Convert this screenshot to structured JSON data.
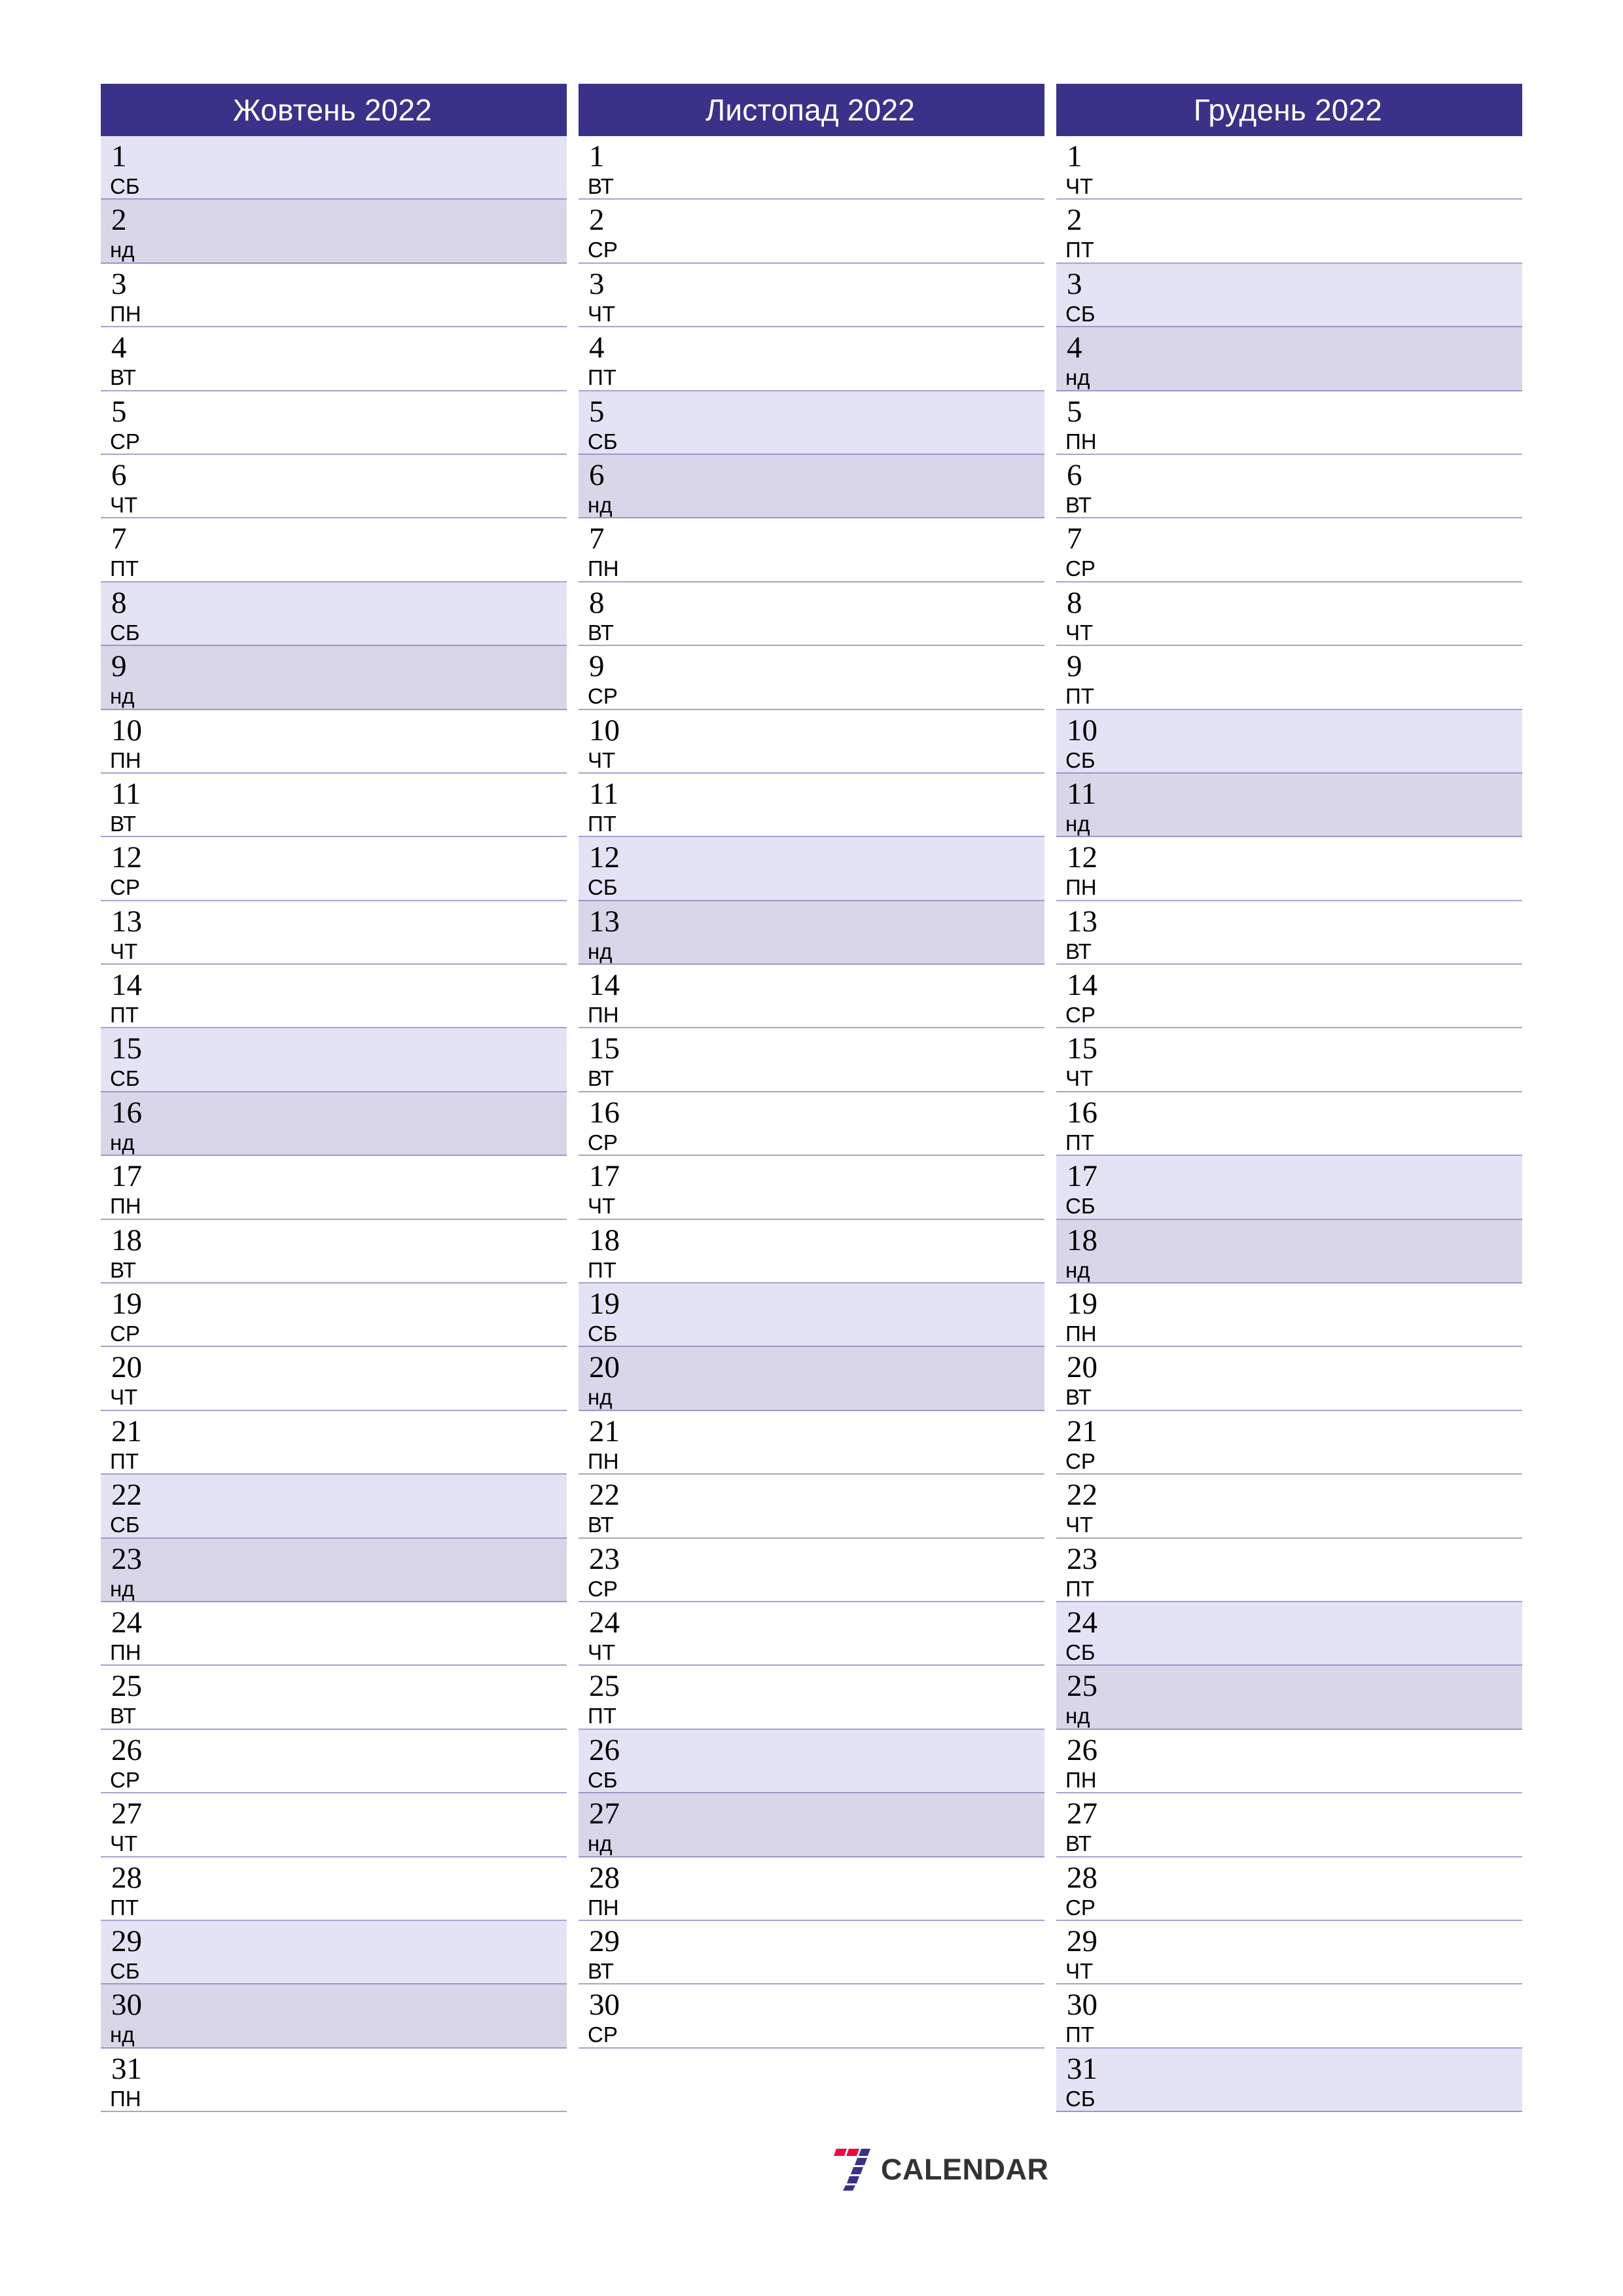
{
  "colors": {
    "header_bg": "#3a3189",
    "saturday_bg": "#e3e3f5",
    "sunday_bg": "#dad6e9",
    "rule": "#9a97c6",
    "logo_red": "#ee0a3f",
    "logo_navy": "#3a3189",
    "logo_text": "#333333",
    "text": "#000000"
  },
  "logo": {
    "mark": "seven-bars-icon",
    "word": "CALENDAR"
  },
  "months": [
    {
      "title": "Жовтень 2022",
      "days": [
        {
          "num": "1",
          "abbr": "СБ",
          "kind": "sat"
        },
        {
          "num": "2",
          "abbr": "нд",
          "kind": "sun"
        },
        {
          "num": "3",
          "abbr": "ПН",
          "kind": "weekday"
        },
        {
          "num": "4",
          "abbr": "ВТ",
          "kind": "weekday"
        },
        {
          "num": "5",
          "abbr": "СР",
          "kind": "weekday"
        },
        {
          "num": "6",
          "abbr": "ЧТ",
          "kind": "weekday"
        },
        {
          "num": "7",
          "abbr": "ПТ",
          "kind": "weekday"
        },
        {
          "num": "8",
          "abbr": "СБ",
          "kind": "sat"
        },
        {
          "num": "9",
          "abbr": "нд",
          "kind": "sun"
        },
        {
          "num": "10",
          "abbr": "ПН",
          "kind": "weekday"
        },
        {
          "num": "11",
          "abbr": "ВТ",
          "kind": "weekday"
        },
        {
          "num": "12",
          "abbr": "СР",
          "kind": "weekday"
        },
        {
          "num": "13",
          "abbr": "ЧТ",
          "kind": "weekday"
        },
        {
          "num": "14",
          "abbr": "ПТ",
          "kind": "weekday"
        },
        {
          "num": "15",
          "abbr": "СБ",
          "kind": "sat"
        },
        {
          "num": "16",
          "abbr": "нд",
          "kind": "sun"
        },
        {
          "num": "17",
          "abbr": "ПН",
          "kind": "weekday"
        },
        {
          "num": "18",
          "abbr": "ВТ",
          "kind": "weekday"
        },
        {
          "num": "19",
          "abbr": "СР",
          "kind": "weekday"
        },
        {
          "num": "20",
          "abbr": "ЧТ",
          "kind": "weekday"
        },
        {
          "num": "21",
          "abbr": "ПТ",
          "kind": "weekday"
        },
        {
          "num": "22",
          "abbr": "СБ",
          "kind": "sat"
        },
        {
          "num": "23",
          "abbr": "нд",
          "kind": "sun"
        },
        {
          "num": "24",
          "abbr": "ПН",
          "kind": "weekday"
        },
        {
          "num": "25",
          "abbr": "ВТ",
          "kind": "weekday"
        },
        {
          "num": "26",
          "abbr": "СР",
          "kind": "weekday"
        },
        {
          "num": "27",
          "abbr": "ЧТ",
          "kind": "weekday"
        },
        {
          "num": "28",
          "abbr": "ПТ",
          "kind": "weekday"
        },
        {
          "num": "29",
          "abbr": "СБ",
          "kind": "sat"
        },
        {
          "num": "30",
          "abbr": "нд",
          "kind": "sun"
        },
        {
          "num": "31",
          "abbr": "ПН",
          "kind": "weekday"
        }
      ]
    },
    {
      "title": "Листопад 2022",
      "days": [
        {
          "num": "1",
          "abbr": "ВТ",
          "kind": "weekday"
        },
        {
          "num": "2",
          "abbr": "СР",
          "kind": "weekday"
        },
        {
          "num": "3",
          "abbr": "ЧТ",
          "kind": "weekday"
        },
        {
          "num": "4",
          "abbr": "ПТ",
          "kind": "weekday"
        },
        {
          "num": "5",
          "abbr": "СБ",
          "kind": "sat"
        },
        {
          "num": "6",
          "abbr": "нд",
          "kind": "sun"
        },
        {
          "num": "7",
          "abbr": "ПН",
          "kind": "weekday"
        },
        {
          "num": "8",
          "abbr": "ВТ",
          "kind": "weekday"
        },
        {
          "num": "9",
          "abbr": "СР",
          "kind": "weekday"
        },
        {
          "num": "10",
          "abbr": "ЧТ",
          "kind": "weekday"
        },
        {
          "num": "11",
          "abbr": "ПТ",
          "kind": "weekday"
        },
        {
          "num": "12",
          "abbr": "СБ",
          "kind": "sat"
        },
        {
          "num": "13",
          "abbr": "нд",
          "kind": "sun"
        },
        {
          "num": "14",
          "abbr": "ПН",
          "kind": "weekday"
        },
        {
          "num": "15",
          "abbr": "ВТ",
          "kind": "weekday"
        },
        {
          "num": "16",
          "abbr": "СР",
          "kind": "weekday"
        },
        {
          "num": "17",
          "abbr": "ЧТ",
          "kind": "weekday"
        },
        {
          "num": "18",
          "abbr": "ПТ",
          "kind": "weekday"
        },
        {
          "num": "19",
          "abbr": "СБ",
          "kind": "sat"
        },
        {
          "num": "20",
          "abbr": "нд",
          "kind": "sun"
        },
        {
          "num": "21",
          "abbr": "ПН",
          "kind": "weekday"
        },
        {
          "num": "22",
          "abbr": "ВТ",
          "kind": "weekday"
        },
        {
          "num": "23",
          "abbr": "СР",
          "kind": "weekday"
        },
        {
          "num": "24",
          "abbr": "ЧТ",
          "kind": "weekday"
        },
        {
          "num": "25",
          "abbr": "ПТ",
          "kind": "weekday"
        },
        {
          "num": "26",
          "abbr": "СБ",
          "kind": "sat"
        },
        {
          "num": "27",
          "abbr": "нд",
          "kind": "sun"
        },
        {
          "num": "28",
          "abbr": "ПН",
          "kind": "weekday"
        },
        {
          "num": "29",
          "abbr": "ВТ",
          "kind": "weekday"
        },
        {
          "num": "30",
          "abbr": "СР",
          "kind": "weekday"
        }
      ]
    },
    {
      "title": "Грудень 2022",
      "days": [
        {
          "num": "1",
          "abbr": "ЧТ",
          "kind": "weekday"
        },
        {
          "num": "2",
          "abbr": "ПТ",
          "kind": "weekday"
        },
        {
          "num": "3",
          "abbr": "СБ",
          "kind": "sat"
        },
        {
          "num": "4",
          "abbr": "нд",
          "kind": "sun"
        },
        {
          "num": "5",
          "abbr": "ПН",
          "kind": "weekday"
        },
        {
          "num": "6",
          "abbr": "ВТ",
          "kind": "weekday"
        },
        {
          "num": "7",
          "abbr": "СР",
          "kind": "weekday"
        },
        {
          "num": "8",
          "abbr": "ЧТ",
          "kind": "weekday"
        },
        {
          "num": "9",
          "abbr": "ПТ",
          "kind": "weekday"
        },
        {
          "num": "10",
          "abbr": "СБ",
          "kind": "sat"
        },
        {
          "num": "11",
          "abbr": "нд",
          "kind": "sun"
        },
        {
          "num": "12",
          "abbr": "ПН",
          "kind": "weekday"
        },
        {
          "num": "13",
          "abbr": "ВТ",
          "kind": "weekday"
        },
        {
          "num": "14",
          "abbr": "СР",
          "kind": "weekday"
        },
        {
          "num": "15",
          "abbr": "ЧТ",
          "kind": "weekday"
        },
        {
          "num": "16",
          "abbr": "ПТ",
          "kind": "weekday"
        },
        {
          "num": "17",
          "abbr": "СБ",
          "kind": "sat"
        },
        {
          "num": "18",
          "abbr": "нд",
          "kind": "sun"
        },
        {
          "num": "19",
          "abbr": "ПН",
          "kind": "weekday"
        },
        {
          "num": "20",
          "abbr": "ВТ",
          "kind": "weekday"
        },
        {
          "num": "21",
          "abbr": "СР",
          "kind": "weekday"
        },
        {
          "num": "22",
          "abbr": "ЧТ",
          "kind": "weekday"
        },
        {
          "num": "23",
          "abbr": "ПТ",
          "kind": "weekday"
        },
        {
          "num": "24",
          "abbr": "СБ",
          "kind": "sat"
        },
        {
          "num": "25",
          "abbr": "нд",
          "kind": "sun"
        },
        {
          "num": "26",
          "abbr": "ПН",
          "kind": "weekday"
        },
        {
          "num": "27",
          "abbr": "ВТ",
          "kind": "weekday"
        },
        {
          "num": "28",
          "abbr": "СР",
          "kind": "weekday"
        },
        {
          "num": "29",
          "abbr": "ЧТ",
          "kind": "weekday"
        },
        {
          "num": "30",
          "abbr": "ПТ",
          "kind": "weekday"
        },
        {
          "num": "31",
          "abbr": "СБ",
          "kind": "sat"
        }
      ]
    }
  ]
}
